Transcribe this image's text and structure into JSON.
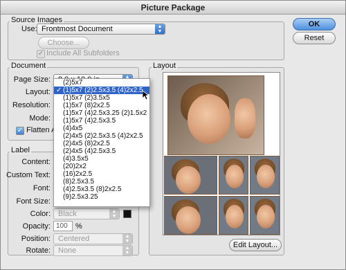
{
  "window": {
    "title": "Picture Package"
  },
  "buttons": {
    "ok": "OK",
    "reset": "Reset",
    "choose": "Choose...",
    "edit_layout": "Edit Layout..."
  },
  "source_images": {
    "group_title": "Source Images",
    "use_label": "Use:",
    "use_value": "Frontmost Document",
    "include_subfolders": "Include All Subfolders"
  },
  "document": {
    "group_title": "Document",
    "page_size_label": "Page Size:",
    "page_size_value": "8.0 x 10.0 in",
    "layout_label": "Layout:",
    "resolution_label": "Resolution:",
    "mode_label": "Mode:",
    "flatten_label": "Flatten All"
  },
  "layout_menu": {
    "items": [
      "(2)5x7",
      "(1)5x7 (2)2.5x3.5 (4)2x2.5",
      "(1)5x7 (2)3.5x5",
      "(1)5x7 (8)2x2.5",
      "(1)5x7 (4)2.5x3.25 (2)1.5x2",
      "(1)5x7 (4)2.5x3.5",
      "(4)4x5",
      "(2)4x5 (2)2.5x3.5 (4)2x2.5",
      "(2)4x5 (8)2x2.5",
      "(2)4x5 (4)2.5x3.5",
      "(4)3.5x5",
      "(20)2x2",
      "(16)2x2.5",
      "(8)2.5x3.5",
      "(4)2.5x3.5 (8)2x2.5",
      "(9)2.5x3.25"
    ],
    "selected_index": 1,
    "check": "✓"
  },
  "label_group": {
    "group_title": "Label",
    "content_label": "Content:",
    "custom_text_label": "Custom Text:",
    "font_label": "Font:",
    "font_size_label": "Font Size:",
    "color_label": "Color:",
    "color_value": "Black",
    "opacity_label": "Opacity:",
    "opacity_value": "100",
    "opacity_unit": "%",
    "position_label": "Position:",
    "position_value": "Centered",
    "rotate_label": "Rotate:",
    "rotate_value": "None"
  },
  "layout_group": {
    "group_title": "Layout"
  },
  "colors": {
    "accent": "#2f64c9",
    "button_default": "#4f8fdc"
  }
}
